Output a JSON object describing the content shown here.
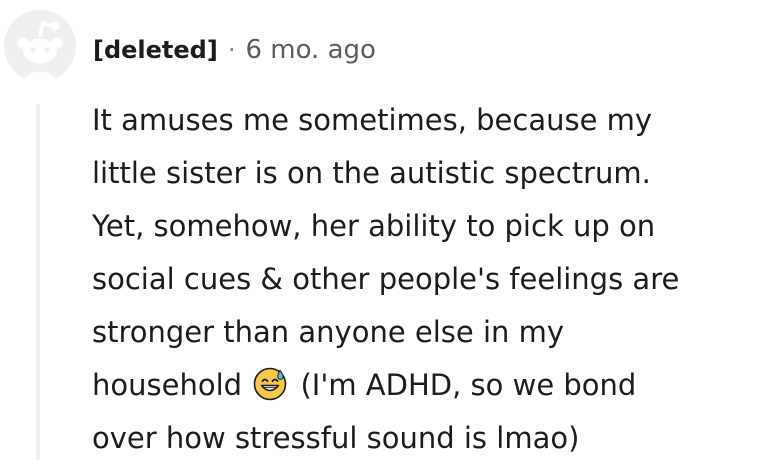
{
  "comment": {
    "author": "[deleted]",
    "separator": "·",
    "timestamp": "6 mo. ago",
    "avatar_icon": "deleted-user-snoo-icon",
    "lines": {
      "l1": "It amuses me sometimes, because my",
      "l2": "little sister is on the autistic spectrum.",
      "l3": "Yet, somehow, her ability to pick up on",
      "l4": "social cues & other people's feelings are",
      "l5": "stronger than anyone else in my",
      "l6_before": "household",
      "l6_after": "(I'm ADHD, so we bond",
      "l7": "over how stressful sound is lmao)"
    },
    "emoji": "grinning-face-with-sweat-emoji"
  },
  "colors": {
    "text": "#1c1c1c",
    "meta_gray": "#5a5c5e",
    "avatar_bg": "#edeff1",
    "avatar_fg": "#d7dadc",
    "thread_line": "#edeff1",
    "emoji_yellow": "#f7c84a"
  }
}
